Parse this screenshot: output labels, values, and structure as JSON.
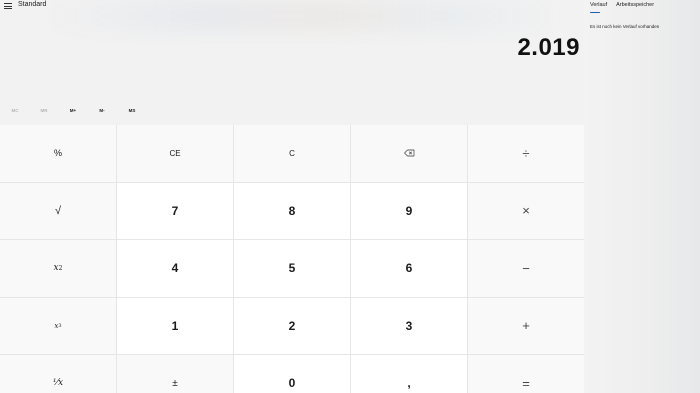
{
  "header": {
    "mode_title": "Standard",
    "menu_icon": "hamburger-icon"
  },
  "display": {
    "value": "2.019"
  },
  "memory": [
    {
      "label": "MC",
      "enabled": false
    },
    {
      "label": "MR",
      "enabled": false
    },
    {
      "label": "M+",
      "enabled": true
    },
    {
      "label": "M-",
      "enabled": true
    },
    {
      "label": "MS",
      "enabled": true
    }
  ],
  "keys": {
    "percent": "%",
    "ce": "CE",
    "c": "C",
    "backspace_icon": "backspace-icon",
    "divide": "÷",
    "sqrt": "√",
    "seven": "7",
    "eight": "8",
    "nine": "9",
    "multiply": "×",
    "square_base": "x",
    "square_exp": "2",
    "four": "4",
    "five": "5",
    "six": "6",
    "minus": "−",
    "cube_base": "x",
    "cube_exp": "3",
    "one": "1",
    "two": "2",
    "three": "3",
    "plus": "+",
    "reciprocal": "¹⁄x",
    "negate": "±",
    "zero": "0",
    "decimal": ",",
    "equals": "="
  },
  "history": {
    "tab_history": "Verlauf",
    "tab_memory": "Arbeitsspeicher",
    "empty_message": "Es ist noch kein Verlauf vorhanden"
  },
  "colors": {
    "accent": "#1b5fb4",
    "number_key_bg": "#ffffff",
    "function_key_bg": "#f9f9f9"
  }
}
